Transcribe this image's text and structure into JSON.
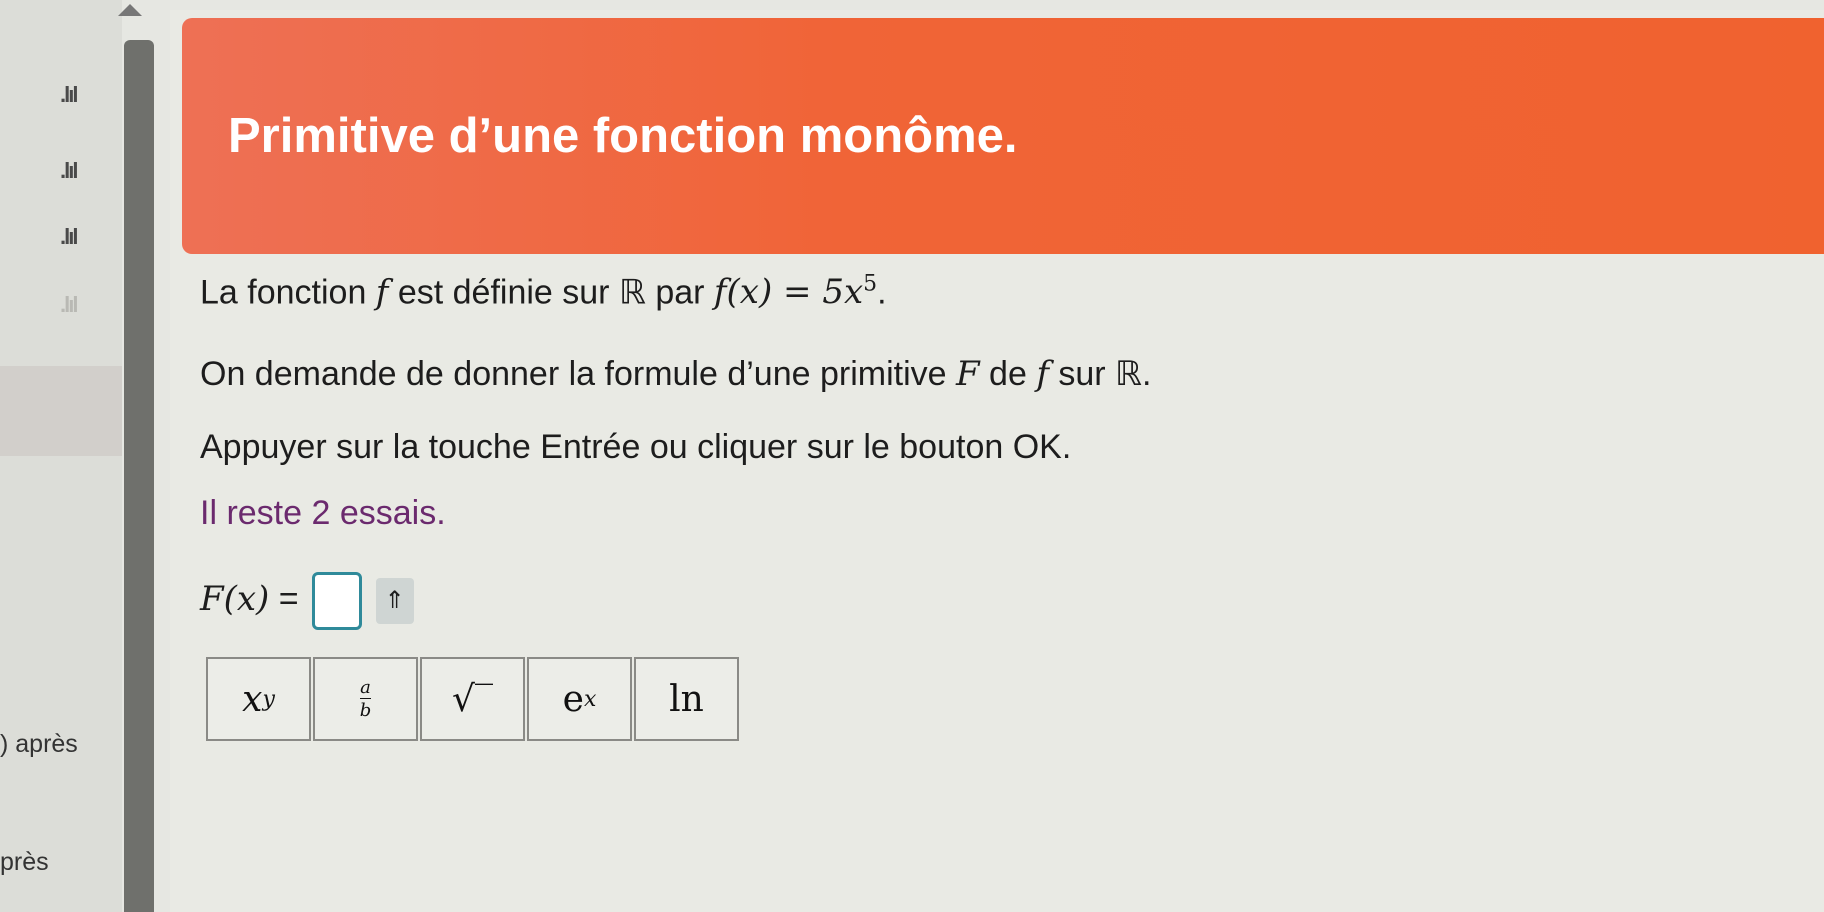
{
  "sidebar": {
    "signal_icon": ".lıl",
    "text_apres_1": ") après",
    "text_apres_2": "près"
  },
  "header": {
    "title": "Primitive d’une fonction monôme."
  },
  "question": {
    "line1_prefix": "La fonction ",
    "line1_f": "f",
    "line1_mid": " est définie sur ℝ par ",
    "line1_formula": "f(x) = 5x",
    "line1_exponent": "5",
    "line1_suffix": ".",
    "line2_prefix": "On demande de donner la formule d’une primitive ",
    "line2_F": "F",
    "line2_mid": " de ",
    "line2_f": "f",
    "line2_suffix": " sur ℝ.",
    "instruction": "Appuyer sur la touche Entrée ou cliquer sur le bouton OK.",
    "remaining": "Il reste 2 essais."
  },
  "answer": {
    "label": "F(x)",
    "equals": "=",
    "toggle_symbol": "⇑"
  },
  "toolbar": {
    "power_base": "x",
    "power_exp": "y",
    "frac_num": "a",
    "frac_den": "b",
    "sqrt": "√‾",
    "exp_base": "e",
    "exp_exp": "x",
    "ln": "ln"
  },
  "colors": {
    "header_orange": "#f0622f",
    "remaining_purple": "#6b2a6e",
    "input_border": "#2f8a9a"
  }
}
